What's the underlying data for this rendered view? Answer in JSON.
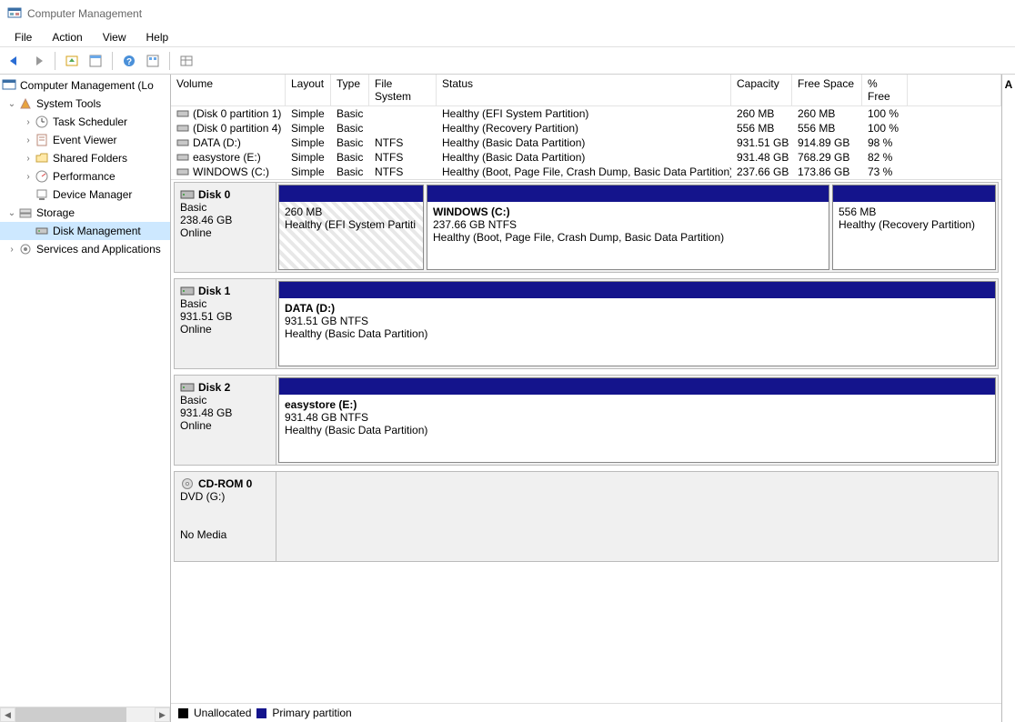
{
  "window": {
    "title": "Computer Management"
  },
  "menu": {
    "file": "File",
    "action": "Action",
    "view": "View",
    "help": "Help"
  },
  "tree": {
    "root": "Computer Management (Lo",
    "systools": "System Tools",
    "tasksched": "Task Scheduler",
    "eventvwr": "Event Viewer",
    "shared": "Shared Folders",
    "perf": "Performance",
    "devmgr": "Device Manager",
    "storage": "Storage",
    "diskmgmt": "Disk Management",
    "services": "Services and Applications"
  },
  "volcols": {
    "volume": "Volume",
    "layout": "Layout",
    "type": "Type",
    "fs": "File System",
    "status": "Status",
    "capacity": "Capacity",
    "free": "Free Space",
    "pct": "% Free"
  },
  "volumes": [
    {
      "name": "(Disk 0 partition 1)",
      "layout": "Simple",
      "type": "Basic",
      "fs": "",
      "status": "Healthy (EFI System Partition)",
      "cap": "260 MB",
      "free": "260 MB",
      "pct": "100 %"
    },
    {
      "name": "(Disk 0 partition 4)",
      "layout": "Simple",
      "type": "Basic",
      "fs": "",
      "status": "Healthy (Recovery Partition)",
      "cap": "556 MB",
      "free": "556 MB",
      "pct": "100 %"
    },
    {
      "name": "DATA (D:)",
      "layout": "Simple",
      "type": "Basic",
      "fs": "NTFS",
      "status": "Healthy (Basic Data Partition)",
      "cap": "931.51 GB",
      "free": "914.89 GB",
      "pct": "98 %"
    },
    {
      "name": "easystore (E:)",
      "layout": "Simple",
      "type": "Basic",
      "fs": "NTFS",
      "status": "Healthy (Basic Data Partition)",
      "cap": "931.48 GB",
      "free": "768.29 GB",
      "pct": "82 %"
    },
    {
      "name": "WINDOWS (C:)",
      "layout": "Simple",
      "type": "Basic",
      "fs": "NTFS",
      "status": "Healthy (Boot, Page File, Crash Dump, Basic Data Partition)",
      "cap": "237.66 GB",
      "free": "173.86 GB",
      "pct": "73 %"
    }
  ],
  "disks": {
    "d0": {
      "name": "Disk 0",
      "type": "Basic",
      "size": "238.46 GB",
      "state": "Online",
      "parts": [
        {
          "title": "",
          "line2": "260 MB",
          "line3": "Healthy (EFI System Partiti",
          "efi": true,
          "flex": "0 0 160px"
        },
        {
          "title": "WINDOWS  (C:)",
          "line2": "237.66 GB NTFS",
          "line3": "Healthy (Boot, Page File, Crash Dump, Basic Data Partition)",
          "flex": "1 1 auto"
        },
        {
          "title": "",
          "line2": "556 MB",
          "line3": "Healthy (Recovery Partition)",
          "flex": "0 0 180px"
        }
      ]
    },
    "d1": {
      "name": "Disk 1",
      "type": "Basic",
      "size": "931.51 GB",
      "state": "Online",
      "parts": [
        {
          "title": "DATA  (D:)",
          "line2": "931.51 GB NTFS",
          "line3": "Healthy (Basic Data Partition)",
          "flex": "1 1 auto"
        }
      ]
    },
    "d2": {
      "name": "Disk 2",
      "type": "Basic",
      "size": "931.48 GB",
      "state": "Online",
      "parts": [
        {
          "title": "easystore  (E:)",
          "line2": "931.48 GB NTFS",
          "line3": "Healthy (Basic Data Partition)",
          "flex": "1 1 auto"
        }
      ]
    },
    "cd": {
      "name": "CD-ROM 0",
      "type": "DVD (G:)",
      "size": "",
      "state": "No Media"
    }
  },
  "legend": {
    "unalloc": "Unallocated",
    "primary": "Primary partition"
  },
  "rightheader": "A"
}
